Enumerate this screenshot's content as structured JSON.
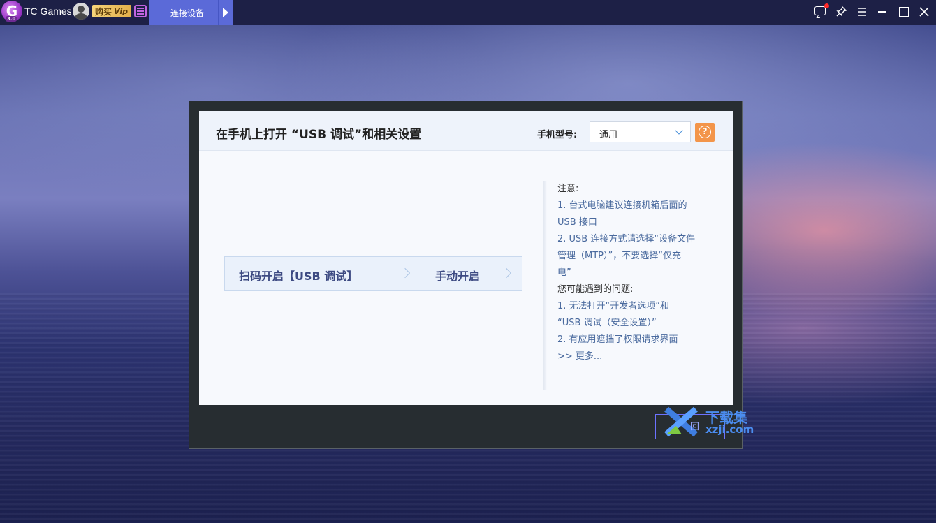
{
  "app": {
    "name": "TC Games",
    "logo_letter": "G",
    "logo_version": "3.0",
    "buy_label": "购买",
    "vip_label": "Vip"
  },
  "tabs": [
    {
      "label": "连接设备"
    }
  ],
  "window_controls": {
    "icons": [
      "chat-icon",
      "pin-icon",
      "menu-icon",
      "minimize-icon",
      "maximize-icon",
      "close-icon"
    ]
  },
  "dialog": {
    "title": "在手机上打开 “USB 调试”和相关设置",
    "model_label": "手机型号:",
    "model_value": "通用",
    "help_symbol": "?",
    "buttons": {
      "scan": "扫码开启【USB 调试】",
      "manual": "手动开启"
    },
    "notes": {
      "heading": "注意:",
      "items": [
        "1. 台式电脑建议连接机箱后面的",
        "USB 接口",
        "2. USB 连接方式请选择“设备文件",
        "管理（MTP）”，不要选择“仅充",
        "电”"
      ],
      "problems_heading": "您可能遇到的问题:",
      "problems": [
        "1. 无法打开“开发者选项”和",
        "“USB 调试（安全设置）”",
        "2. 有应用遮挡了权限请求界面"
      ],
      "more": ">> 更多..."
    }
  },
  "watermark": {
    "cn": "下载集",
    "en": "xzji.com",
    "partial": "回"
  },
  "colors": {
    "topbar": "#1d2046",
    "tab_active": "#5b6ad8",
    "accent_orange": "#f3954a",
    "button_text": "#3d4a82",
    "note_link": "#4a6a9e"
  }
}
